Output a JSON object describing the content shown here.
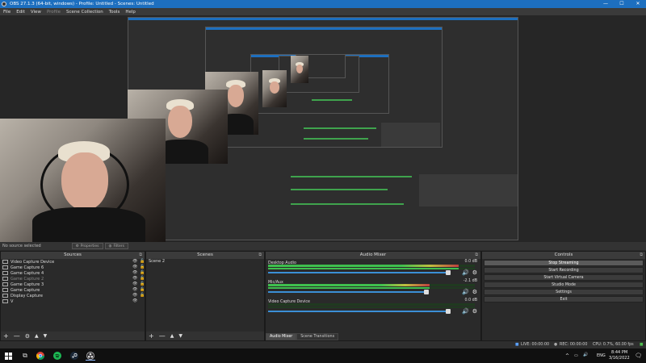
{
  "window": {
    "title": "OBS 27.1.3 (64-bit, windows) - Profile: Untitled - Scenes: Untitled",
    "controls": [
      "—",
      "☐",
      "✕"
    ]
  },
  "menu": [
    {
      "label": "File",
      "enabled": true
    },
    {
      "label": "Edit",
      "enabled": true
    },
    {
      "label": "View",
      "enabled": true
    },
    {
      "label": "Profile",
      "enabled": false
    },
    {
      "label": "Scene Collection",
      "enabled": true
    },
    {
      "label": "Tools",
      "enabled": true
    },
    {
      "label": "Help",
      "enabled": true
    }
  ],
  "source_bar": {
    "status": "No source selected",
    "properties_label": "Properties",
    "filters_label": "Filters"
  },
  "docks": {
    "sources": {
      "title": "Sources",
      "items": [
        {
          "label": "Video Capture Device",
          "icon": "camera-icon",
          "visible": true,
          "dim": false
        },
        {
          "label": "Game Capture 6",
          "icon": "gamepad-icon",
          "visible": true,
          "dim": false
        },
        {
          "label": "Game Capture 4",
          "icon": "gamepad-icon",
          "visible": true,
          "dim": false
        },
        {
          "label": "Game Capture 2",
          "icon": "gamepad-icon",
          "visible": true,
          "dim": true
        },
        {
          "label": "Game Capture 3",
          "icon": "gamepad-icon",
          "visible": true,
          "dim": false
        },
        {
          "label": "Game Capture",
          "icon": "gamepad-icon",
          "visible": true,
          "dim": false
        },
        {
          "label": "Display Capture",
          "icon": "monitor-icon",
          "visible": true,
          "dim": false
        },
        {
          "label": "V",
          "icon": "layer-icon",
          "visible": true,
          "dim": false
        }
      ],
      "footer": [
        "+",
        "—",
        "⚙",
        "▲",
        "▼"
      ]
    },
    "scenes": {
      "title": "Scenes",
      "items": [
        "Scene 2"
      ],
      "footer": [
        "+",
        "—",
        "▲",
        "▼"
      ]
    },
    "audio_mixer": {
      "title": "Audio Mixer",
      "channels": [
        {
          "name": "Desktop Audio",
          "db": "0.0 dB",
          "level": 0.92,
          "volume": 0.98
        },
        {
          "name": "Mic/Aux",
          "db": "-2.1 dB",
          "level": 0.78,
          "volume": 0.86
        },
        {
          "name": "Video Capture Device",
          "db": "0.0 dB",
          "level": 0.0,
          "volume": 0.98
        }
      ],
      "tabs": [
        "Audio Mixer",
        "Scene Transitions"
      ]
    },
    "controls": {
      "title": "Controls",
      "buttons": [
        "Stop Streaming",
        "Start Recording",
        "Start Virtual Camera",
        "Studio Mode",
        "Settings",
        "Exit"
      ]
    }
  },
  "status": {
    "live": "LIVE: 00:00:00",
    "rec": "REC: 00:00:00",
    "cpu": "CPU: 0.7%, 60.00 fps"
  },
  "taskbar": {
    "lang": "ENG",
    "time": "8:44 PM",
    "date": "3/16/2022"
  },
  "colors": {
    "title_bar": "#1d6fbf",
    "accent": "#3b8fd6",
    "meter_green": "#3fbf4e"
  }
}
